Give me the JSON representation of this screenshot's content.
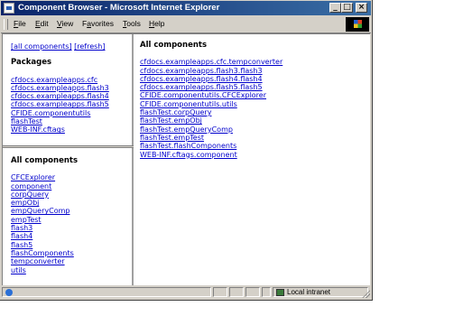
{
  "window": {
    "title": "Component Browser - Microsoft Internet Explorer",
    "buttons": [
      "_",
      "□",
      "×"
    ]
  },
  "menu": [
    "File",
    "Edit",
    "View",
    "Favorites",
    "Tools",
    "Help"
  ],
  "menu_underline": [
    "F",
    "E",
    "V",
    "a",
    "T",
    "H"
  ],
  "left_top": {
    "links": [
      "[all components]",
      "[refresh]"
    ],
    "packages_heading": "Packages",
    "packages": [
      "cfdocs.exampleapps.cfc",
      "cfdocs.exampleapps.flash3",
      "cfdocs.exampleapps.flash4",
      "cfdocs.exampleapps.flash5",
      "CFIDE.componentutils",
      "flashTest",
      "WEB-INF.cftags"
    ]
  },
  "left_bottom": {
    "heading": "All components",
    "items": [
      "CFCExplorer",
      "component",
      "corpQuery",
      "empObj",
      "empQueryComp",
      "empTest",
      "flash3",
      "flash4",
      "flash5",
      "flashComponents",
      "tempconverter",
      "utils"
    ]
  },
  "right": {
    "heading": "All components",
    "items": [
      "cfdocs.exampleapps.cfc.tempconverter",
      "cfdocs.exampleapps.flash3.flash3",
      "cfdocs.exampleapps.flash4.flash4",
      "cfdocs.exampleapps.flash5.flash5",
      "CFIDE.componentutils.CFCExplorer",
      "CFIDE.componentutils.utils",
      "flashTest.corpQuery",
      "flashTest.empObj",
      "flashTest.empQueryComp",
      "flashTest.empTest",
      "flashTest.flashComponents",
      "WEB-INF.cftags.component"
    ]
  },
  "status": {
    "zone": "Local intranet"
  },
  "colors": {
    "link": "#0000cc",
    "titlebar_start": "#0a246a",
    "titlebar_end": "#3a6ea5",
    "chrome": "#d4d0c8"
  },
  "icons": {
    "title": "ie-page-icon",
    "status": "ie-globe-icon",
    "zone": "intranet-zone-icon",
    "brand": "windows-logo-icon"
  }
}
